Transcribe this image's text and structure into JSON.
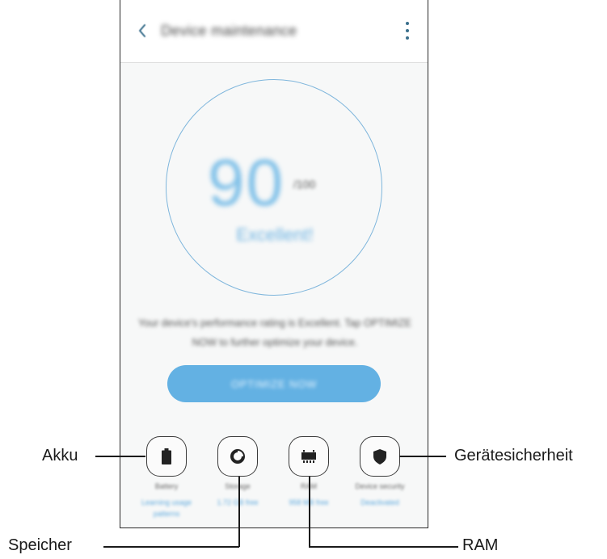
{
  "appbar": {
    "title": "Device maintenance"
  },
  "score": {
    "value": "90",
    "max": "/100",
    "status": "Excellent!"
  },
  "description": "Your device's performance rating is Excellent. Tap OPTIMIZE NOW to further optimize your device.",
  "optimize_button": "OPTIMIZE NOW",
  "features": [
    {
      "label": "Battery",
      "sub": "Learning usage patterns"
    },
    {
      "label": "Storage",
      "sub": "1.72 GB free"
    },
    {
      "label": "RAM",
      "sub": "958 MB free"
    },
    {
      "label": "Device security",
      "sub": "Deactivated"
    }
  ],
  "callouts": {
    "akku": "Akku",
    "speicher": "Speicher",
    "ram": "RAM",
    "geraetesicherheit": "Gerätesicherheit"
  },
  "colors": {
    "accent": "#63b1e3",
    "ring": "#7fb6dc",
    "score_text": "#7fc0e8"
  }
}
